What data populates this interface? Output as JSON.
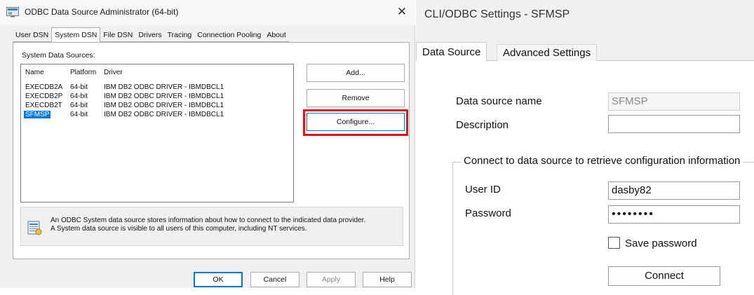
{
  "odbc": {
    "title": "ODBC Data Source Administrator (64-bit)",
    "close_glyph": "✕",
    "tabs": [
      {
        "label": "User DSN"
      },
      {
        "label": "System DSN",
        "active": true
      },
      {
        "label": "File DSN"
      },
      {
        "label": "Drivers"
      },
      {
        "label": "Tracing"
      },
      {
        "label": "Connection Pooling"
      },
      {
        "label": "About"
      }
    ],
    "list_label": "System Data Sources:",
    "columns": {
      "name": "Name",
      "platform": "Platform",
      "driver": "Driver"
    },
    "rows": [
      {
        "name": "EXECDB2A",
        "platform": "64-bit",
        "driver": "IBM DB2 ODBC DRIVER - IBMDBCL1"
      },
      {
        "name": "EXECDB2P",
        "platform": "64-bit",
        "driver": "IBM DB2 ODBC DRIVER - IBMDBCL1"
      },
      {
        "name": "EXECDB2T",
        "platform": "64-bit",
        "driver": "IBM DB2 ODBC DRIVER - IBMDBCL1"
      },
      {
        "name": "SFMSP",
        "platform": "64-bit",
        "driver": "IBM DB2 ODBC DRIVER - IBMDBCL1",
        "selected": true
      }
    ],
    "buttons": {
      "add": "Add...",
      "remove": "Remove",
      "configure": "Configure..."
    },
    "info_line1": "An ODBC System data source stores information about how to connect to the indicated data provider.",
    "info_line2": "A System data source is visible to all users of this computer, including NT services.",
    "footer": {
      "ok": "OK",
      "cancel": "Cancel",
      "apply": "Apply",
      "help": "Help"
    },
    "highlight_color": "#e0151b",
    "selection_color": "#0078d7"
  },
  "cli": {
    "title": "CLI/ODBC Settings - SFMSP",
    "tabs": {
      "data_source": "Data Source",
      "advanced": "Advanced Settings"
    },
    "fields": {
      "dsname_label": "Data source name",
      "dsname_value": "SFMSP",
      "description_label": "Description",
      "description_value": "",
      "group_label": "Connect to data source to retrieve configuration information",
      "userid_label": "User ID",
      "userid_value": "dasby82",
      "password_label": "Password",
      "password_value": "••••••••",
      "save_password_label": "Save password"
    },
    "connect_button": "Connect"
  }
}
